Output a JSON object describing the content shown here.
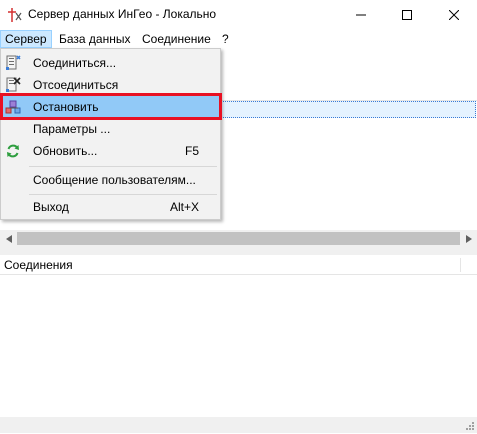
{
  "window": {
    "title": "Сервер данных ИнГео - Локально"
  },
  "menubar": {
    "items": [
      {
        "label": "Сервер"
      },
      {
        "label": "База данных"
      },
      {
        "label": "Соединение"
      },
      {
        "label": "?"
      }
    ]
  },
  "server_menu": {
    "items": [
      {
        "label": "Соединиться...",
        "shortcut": "",
        "icon": "connect-icon"
      },
      {
        "label": "Отсоединиться",
        "shortcut": "",
        "icon": "disconnect-icon"
      },
      {
        "label": "Остановить",
        "shortcut": "",
        "icon": "stop-server-icon"
      },
      {
        "label": "Параметры ...",
        "shortcut": "",
        "icon": ""
      },
      {
        "label": "Обновить...",
        "shortcut": "F5",
        "icon": "refresh-icon"
      },
      {
        "label": "Сообщение пользователям...",
        "shortcut": "",
        "icon": ""
      },
      {
        "label": "Выход",
        "shortcut": "Alt+X",
        "icon": ""
      }
    ]
  },
  "connections_panel": {
    "header": "Соединения"
  },
  "colors": {
    "menu_hover": "#91c9f7",
    "menubar_active": "#cce8ff",
    "highlight_border": "#e81123"
  }
}
